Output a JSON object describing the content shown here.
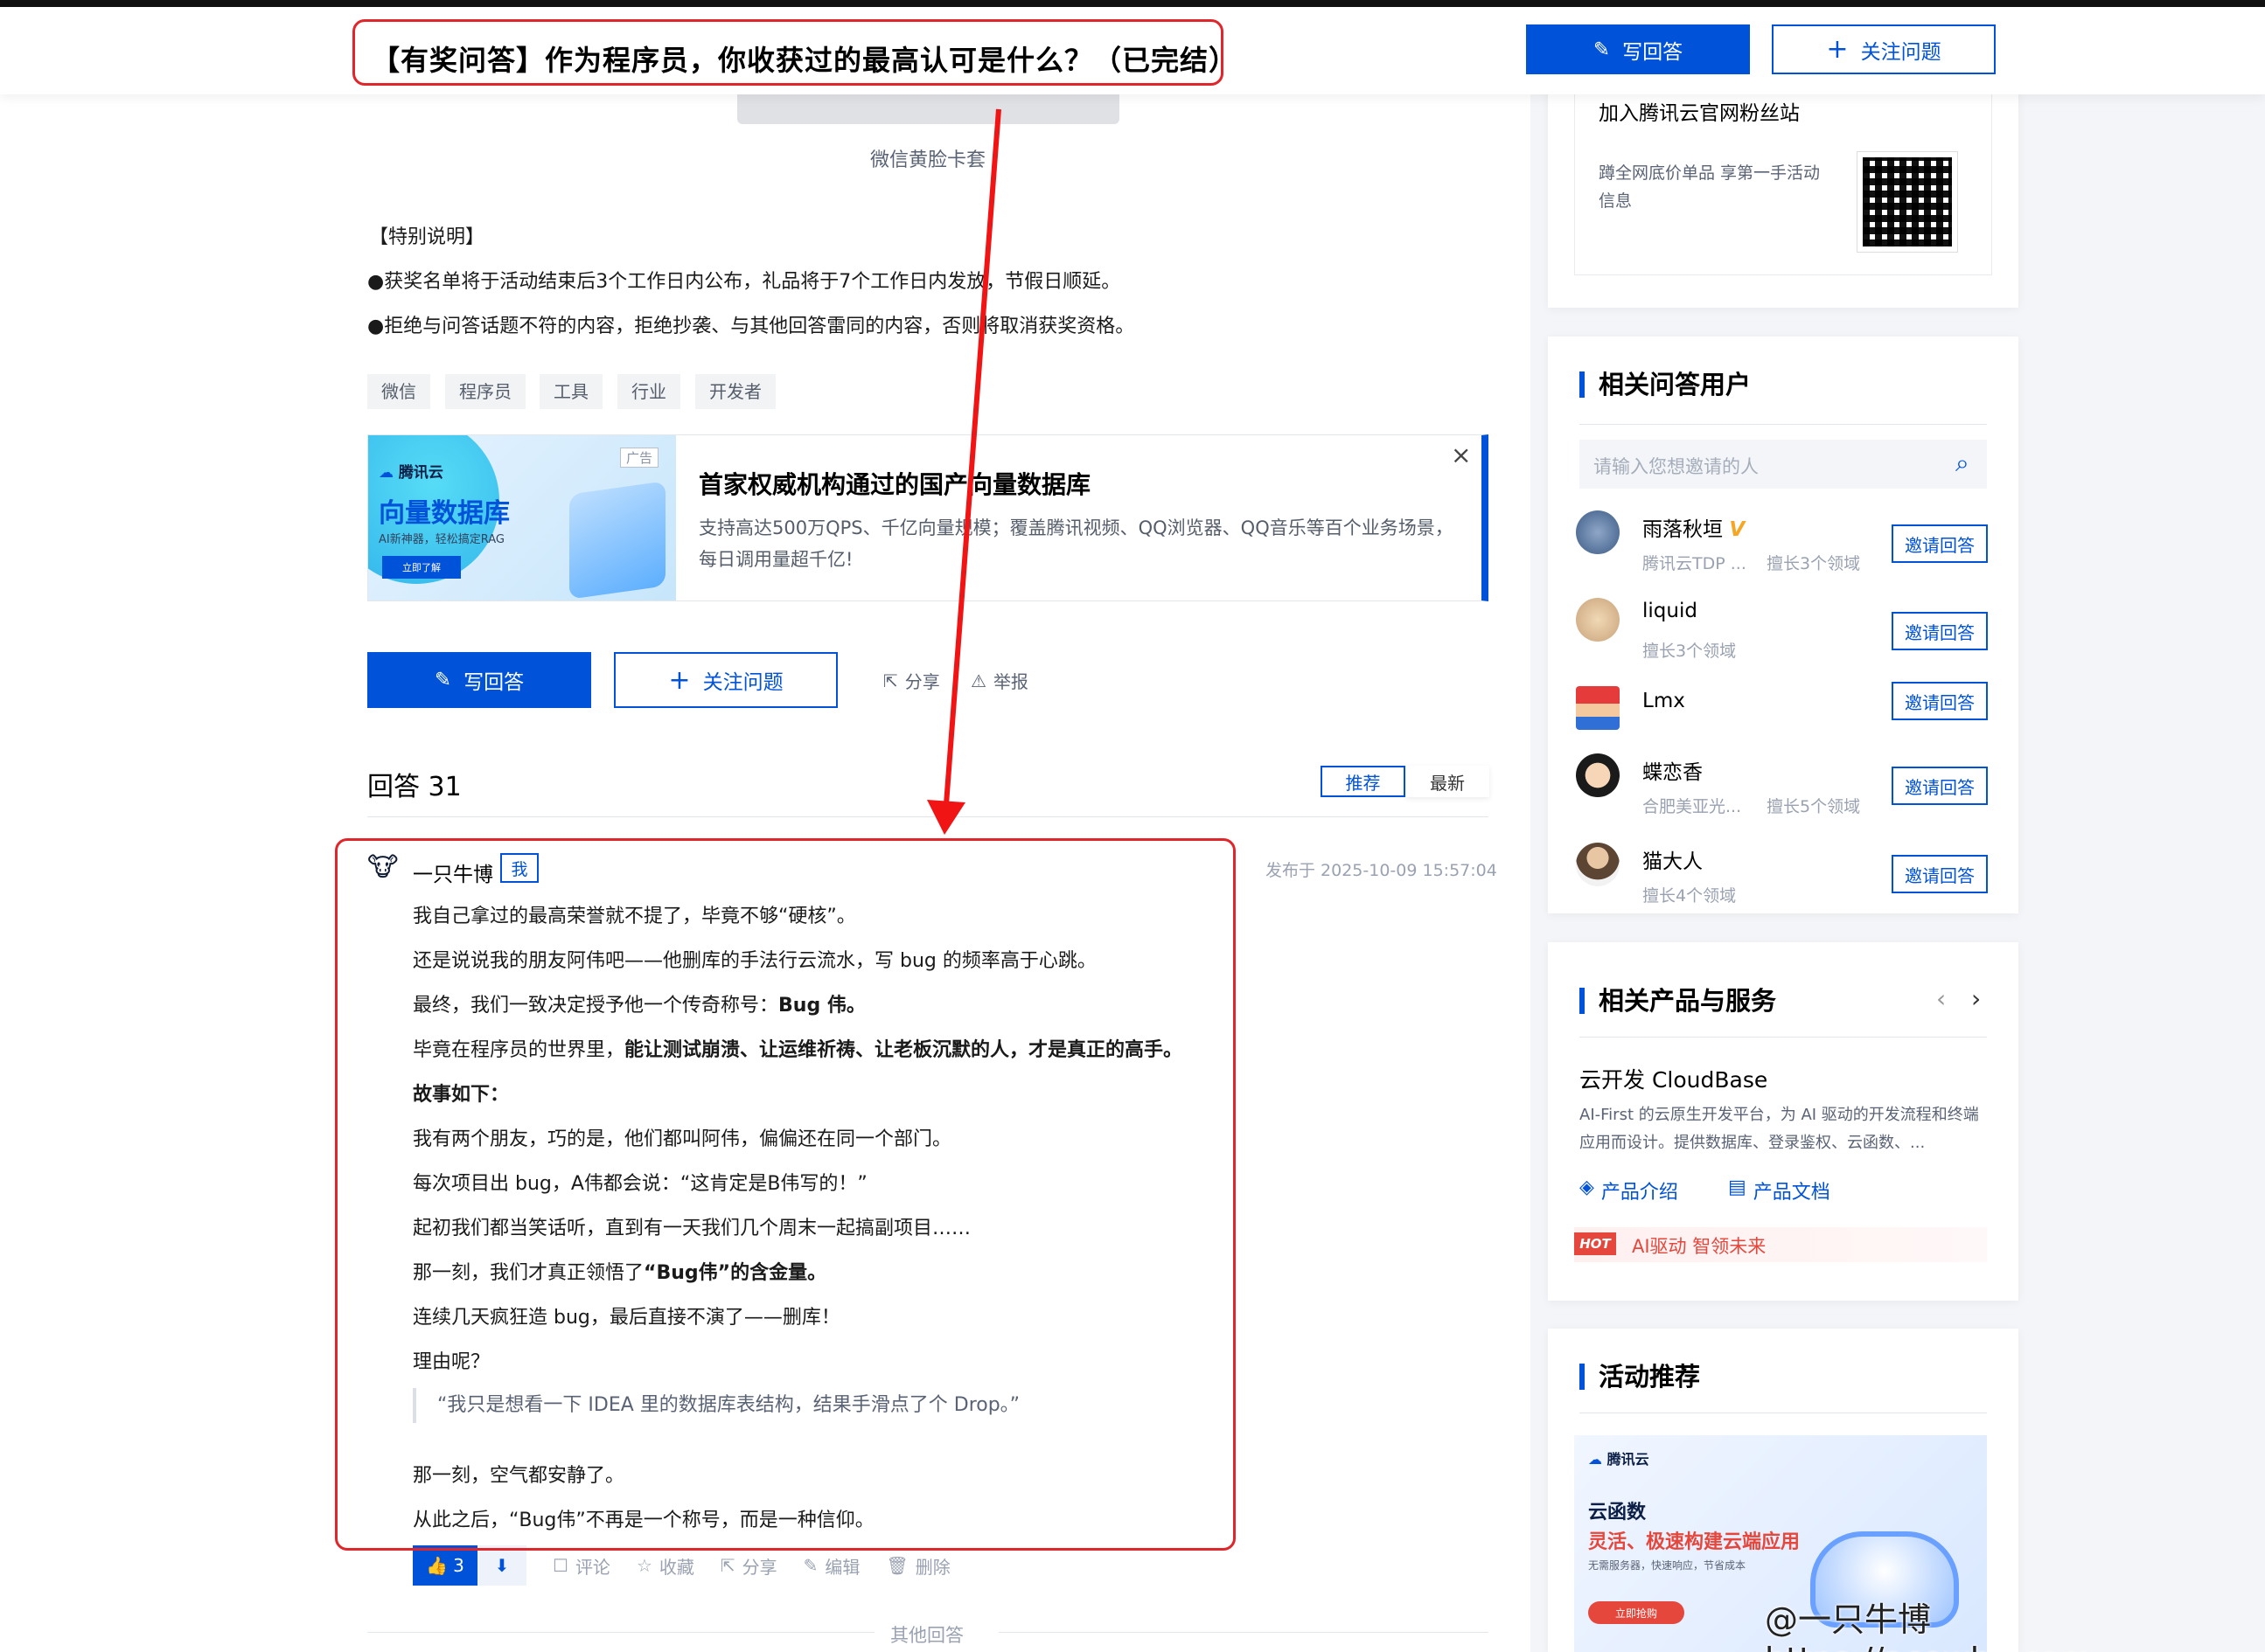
{
  "header": {
    "question_title": "【有奖问答】作为程序员，你收获过的最高认可是什么？（已完结）",
    "write_answer": "写回答",
    "follow_question": "关注问题"
  },
  "content": {
    "image_caption": "微信黄脸卡套",
    "special_note_title": "【特别说明】",
    "notes": [
      "●获奖名单将于活动结束后3个工作日内公布，礼品将于7个工作日内发放，节假日顺延。",
      "●拒绝与问答话题不符的内容，拒绝抄袭、与其他回答雷同的内容，否则将取消获奖资格。"
    ],
    "tags": [
      "微信",
      "程序员",
      "工具",
      "行业",
      "开发者"
    ]
  },
  "ad": {
    "brand": "腾讯云",
    "img_title": "向量数据库",
    "img_sub": "AI新神器，轻松搞定RAG",
    "img_btn": "立即了解",
    "badge": "广告",
    "title": "首家权威机构通过的国产向量数据库",
    "desc": "支持高达500万QPS、千亿向量规模；覆盖腾讯视频、QQ浏览器、QQ音乐等百个业务场景，每日调用量超千亿!"
  },
  "actions": {
    "write_answer": "写回答",
    "follow_question": "关注问题",
    "share": "分享",
    "report": "举报"
  },
  "answers": {
    "header": "回答 31",
    "sort_recommend": "推荐",
    "sort_latest": "最新"
  },
  "answer": {
    "author": "一只牛博",
    "me_badge": "我",
    "published": "发布于 2025-10-09 15:57:04",
    "lines": [
      "我自己拿过的最高荣誉就不提了，毕竟不够“硬核”。",
      "还是说说我的朋友阿伟吧——他删库的手法行云流水，写 bug 的频率高于心跳。",
      "最终，我们一致决定授予他一个传奇称号：",
      "Bug 伟。",
      "毕竟在程序员的世界里，",
      "能让测试崩溃、让运维祈祷、让老板沉默的人，才是真正的高手。",
      "故事如下：",
      "我有两个朋友，巧的是，他们都叫阿伟，偏偏还在同一个部门。",
      "每次项目出 bug，A伟都会说：“这肯定是B伟写的！”",
      "起初我们都当笑话听，直到有一天我们几个周末一起搞副项目……",
      "那一刻，我们才真正领悟了",
      "“Bug伟”的含金量。",
      "连续几天疯狂造 bug，最后直接不演了——删库！",
      "理由呢？",
      "“我只是想看一下 IDEA 里的数据库表结构，结果手滑点了个 Drop。”",
      "那一刻，空气都安静了。",
      "从此之后，“Bug伟”不再是一个称号，而是一种信仰。"
    ],
    "like_count": "3",
    "comment": "评论",
    "collect": "收藏",
    "share": "分享",
    "edit": "编辑",
    "delete": "删除",
    "other_answers": "其他回答"
  },
  "sidebar": {
    "fans": {
      "title": "加入腾讯云官网粉丝站",
      "desc": "蹲全网底价单品 享第一手活动信息"
    },
    "users": {
      "title": "相关问答用户",
      "search_placeholder": "请输入您想邀请的人",
      "invite_label": "邀请回答",
      "list": [
        {
          "name": "雨落秋垣",
          "org": "腾讯云TDP ...",
          "fields": "擅长3个领域"
        },
        {
          "name": "liquid",
          "org": "",
          "fields": "擅长3个领域"
        },
        {
          "name": "Lmx",
          "org": "",
          "fields": ""
        },
        {
          "name": "蝶恋香",
          "org": "合肥美亚光...",
          "fields": "擅长5个领域"
        },
        {
          "name": "猫大人",
          "org": "",
          "fields": "擅长4个领域"
        }
      ]
    },
    "products": {
      "title": "相关产品与服务",
      "name": "云开发 CloudBase",
      "desc": "AI-First 的云原生开发平台，为 AI 驱动的开发流程和终端应用而设计。提供数据库、登录鉴权、云函数、...",
      "intro": "产品介绍",
      "docs": "产品文档",
      "hot_badge": "HOT",
      "hot_text": "AI驱动 智领未来"
    },
    "activity": {
      "title": "活动推荐",
      "brand": "腾讯云",
      "banner_title": "云函数",
      "banner_sub": "灵活、极速构建云端应用",
      "banner_small": "无需服务器，快速响应，节省成本",
      "banner_btn": "立即抢购"
    }
  },
  "watermark": "@一只牛博 https://acowbo.com"
}
